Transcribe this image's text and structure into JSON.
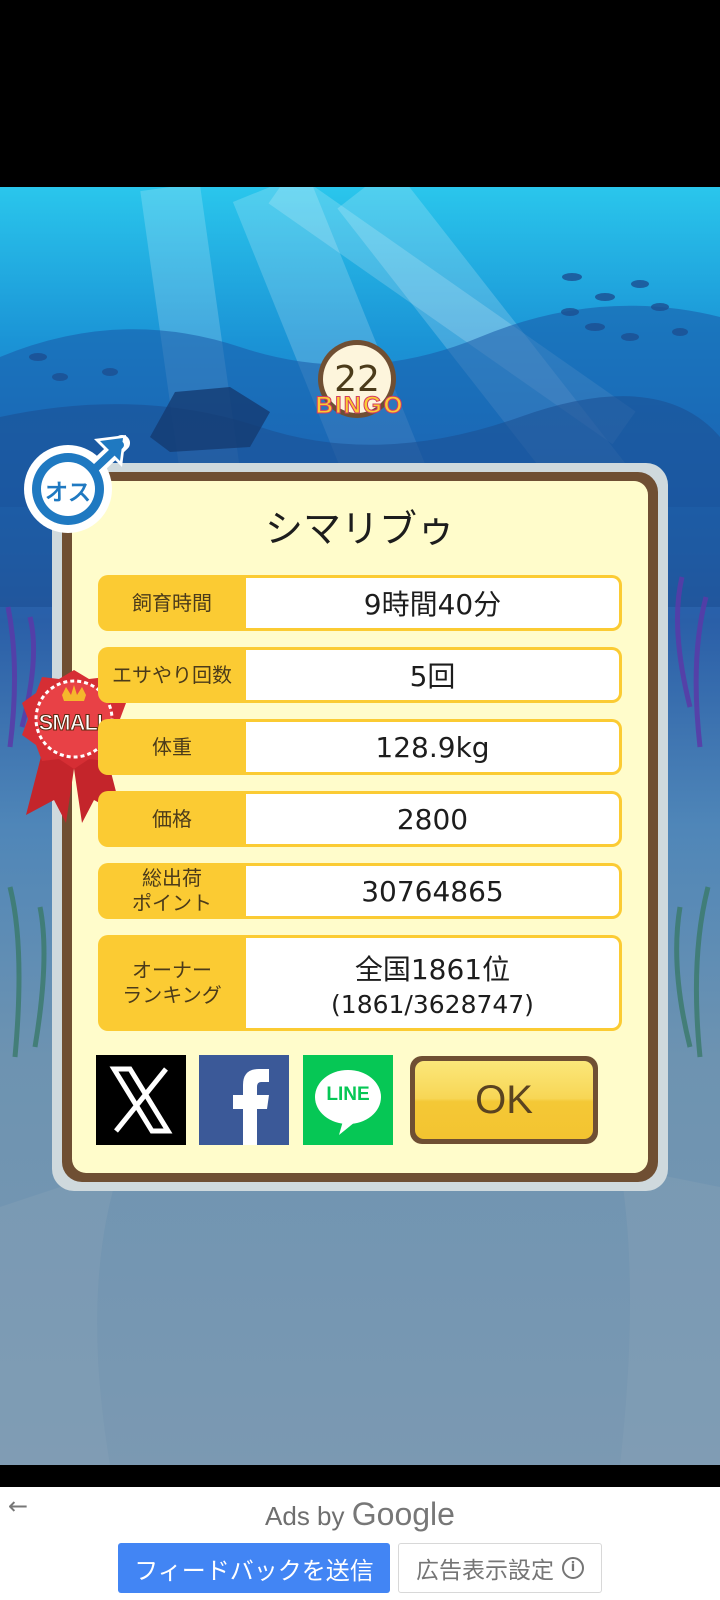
{
  "fish": {
    "name": "シマリブゥ",
    "bingo_number": "22",
    "bingo_label": "BINGO",
    "gender_label": "オス",
    "size_badge": "SMALL"
  },
  "stats": [
    {
      "label": "飼育時間",
      "value": "9時間40分"
    },
    {
      "label": "エサやり回数",
      "value": "5回"
    },
    {
      "label": "体重",
      "value": "128.9kg"
    },
    {
      "label": "価格",
      "value": "2800"
    },
    {
      "label_line1": "総出荷",
      "label_line2": "ポイント",
      "value": "30764865"
    },
    {
      "label_line1": "オーナー",
      "label_line2": "ランキング",
      "value": "全国1861位",
      "value_sub": "(1861/3628747)"
    }
  ],
  "share": {
    "x_icon": "x-logo-icon",
    "facebook_icon": "facebook-logo-icon",
    "line_label": "LINE"
  },
  "ok_label": "OK",
  "ad": {
    "ads_by": "Ads by",
    "google": "Google",
    "feedback_label": "フィードバックを送信",
    "settings_label": "広告表示設定",
    "info_icon": "i"
  },
  "colors": {
    "label_bg": "#fbcb33",
    "card_bg": "#fffccb",
    "frame": "#6f4f33",
    "feedback_blue": "#4285f4"
  }
}
